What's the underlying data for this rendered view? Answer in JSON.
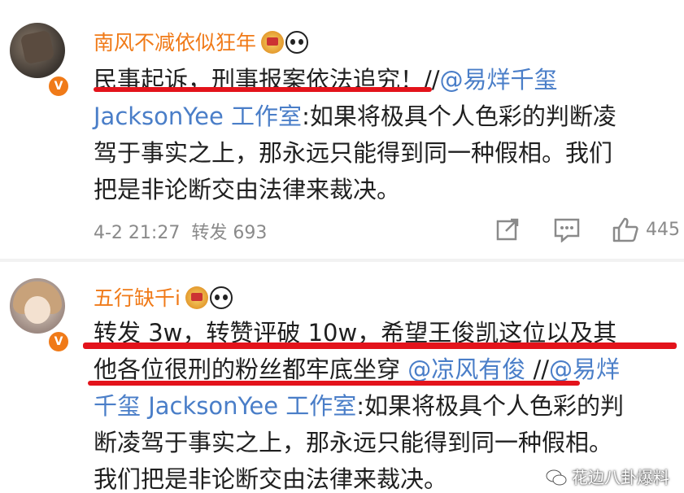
{
  "post1": {
    "username": "南风不减依似狂年",
    "badge": "V",
    "lines": [
      "民事起诉，刑事报案依法追究！//",
      "JacksonYee 工作室:如果将极具个人色彩的判断凌",
      "驾于事实之上，那永远只能得到同一种假相。我们",
      "把是非论断交由法律来裁决。"
    ],
    "mention_line1": "@易烊千玺",
    "mention_line2": "JacksonYee 工作室",
    "line2_rest": ":如果将极具个人色彩的判断凌",
    "timestamp": "4-2 21:27",
    "repost": "转发 693",
    "like_count": "445"
  },
  "post2": {
    "username": "五行缺千i",
    "badge": "V",
    "line1": "转发 3w，转赞评破 10w，希望王俊凯这位以及其",
    "line2_a": "他各位很刑的粉丝都牢底坐穿 ",
    "line2_mention": "@凉风有俊",
    "line2_b": " //",
    "line2_mention2": "@易烊",
    "line3_mention": "千玺 JacksonYee 工作室",
    "line3_rest": ":如果将极具个人色彩的判",
    "line4": "断凌驾于事实之上，那永远只能得到同一种假相。",
    "line5": "我们把是非论断交由法律来裁决。"
  },
  "watermark": "花边八卦爆料",
  "colors": {
    "username": "#f07a18",
    "mention": "#4a7ec8",
    "highlight": "#e3131b",
    "meta": "#8a8a8a"
  },
  "icons": [
    "crown-icon",
    "panda-icon",
    "v-badge-icon",
    "share-icon",
    "comment-icon",
    "like-icon",
    "wechat-icon"
  ]
}
